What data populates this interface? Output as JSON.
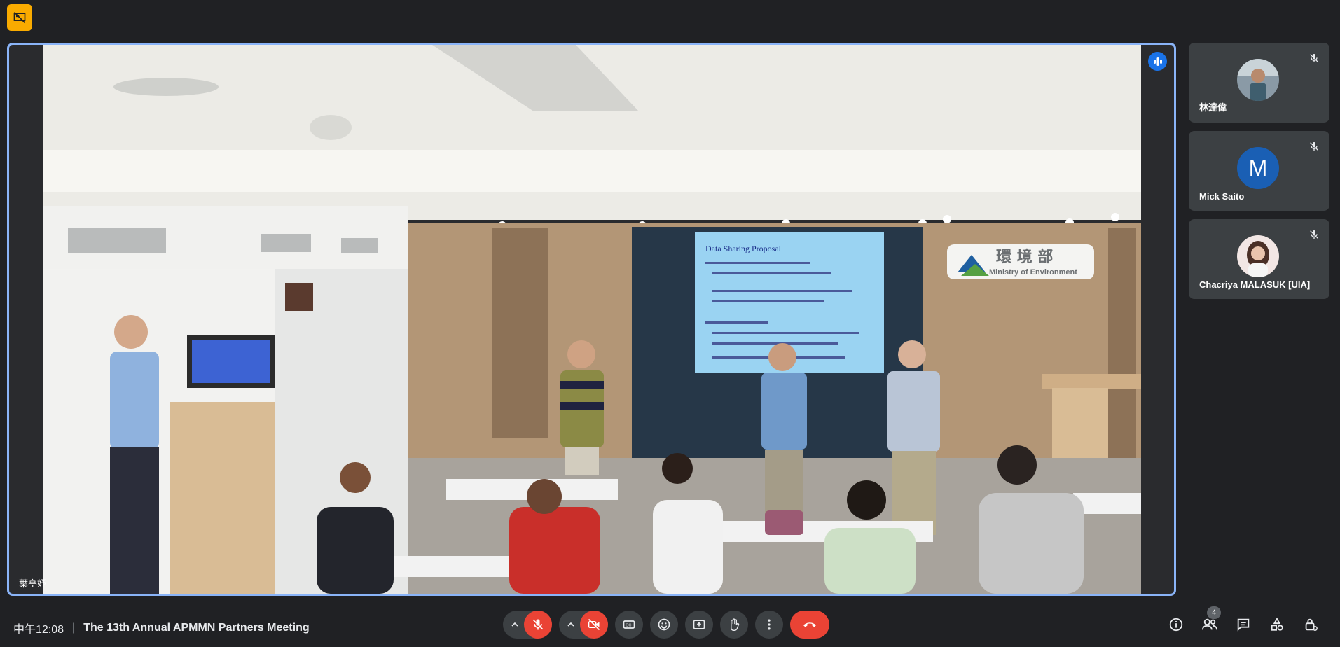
{
  "top_badge": {
    "icon": "presentation-off-icon",
    "color": "#f9ab00"
  },
  "main_tile": {
    "participant_name": "葉亭妤",
    "speaking_icon": "audio-wave-icon",
    "video_description_icons": {
      "sign_text_cn": "環 境 部",
      "sign_text_en": "Ministry of Environment",
      "slide_title": "Data Sharing Proposal"
    }
  },
  "participants": [
    {
      "name": "林達偉",
      "avatar_type": "photo",
      "muted": true
    },
    {
      "name": "Mick Saito",
      "avatar_type": "letter",
      "avatar_letter": "M",
      "muted": true
    },
    {
      "name": "Chacriya MALASUK [UIA]",
      "avatar_type": "photo",
      "muted": true
    }
  ],
  "bottom_bar": {
    "time": "中午12:08",
    "separator": "|",
    "meeting_title": "The 13th Annual APMMN Partners Meeting",
    "people_count": "4"
  },
  "colors": {
    "background": "#202124",
    "tile": "#3c4043",
    "accent_blue": "#8ab4f8",
    "danger_red": "#ea4335"
  }
}
